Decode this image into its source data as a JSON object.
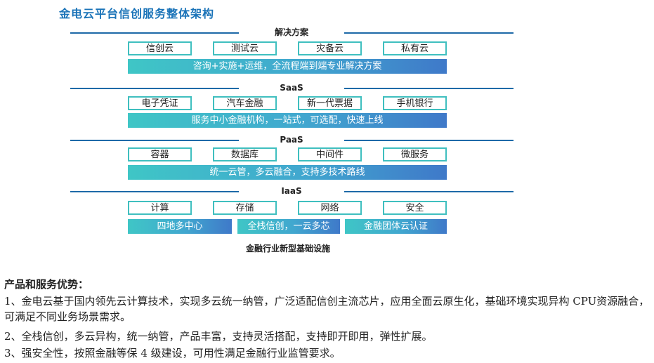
{
  "title": "金电云平台信创服务整体架构",
  "layers": [
    {
      "label": "解决方案",
      "boxes": [
        "信创云",
        "测试云",
        "灾备云",
        "私有云"
      ],
      "bars": [
        "咨询+实施+运维，全流程端到端专业解决方案"
      ]
    },
    {
      "label": "SaaS",
      "boxes": [
        "电子凭证",
        "汽车金融",
        "新一代票据",
        "手机银行"
      ],
      "bars": [
        "服务中小金融机构，一站式，可选配，快速上线"
      ]
    },
    {
      "label": "PaaS",
      "boxes": [
        "容器",
        "数据库",
        "中间件",
        "微服务"
      ],
      "bars": [
        "统一云管，多云融合，支持多技术路线"
      ]
    },
    {
      "label": "IaaS",
      "boxes": [
        "计算",
        "存储",
        "网络",
        "安全"
      ],
      "bars": [
        "四地多中心",
        "全栈信创，一云多芯",
        "金融团体云认证"
      ]
    }
  ],
  "footer": "金融行业新型基础设施",
  "advantages": {
    "title": "产品和服务优势：",
    "items": [
      "1、金电云基于国内领先云计算技术，实现多云统一纳管，广泛适配信创主流芯片，应用全面云原生化，基础环境实现异构 CPU资源融合，可满足不同业务场景需求。",
      "2、全栈信创，多云异构，统一纳管，产品丰富，支持灵活搭配，支持即开即用，弹性扩展。",
      "3、强安全性，按照金融等保 4 级建设，可用性满足金融行业监管要求。"
    ]
  }
}
